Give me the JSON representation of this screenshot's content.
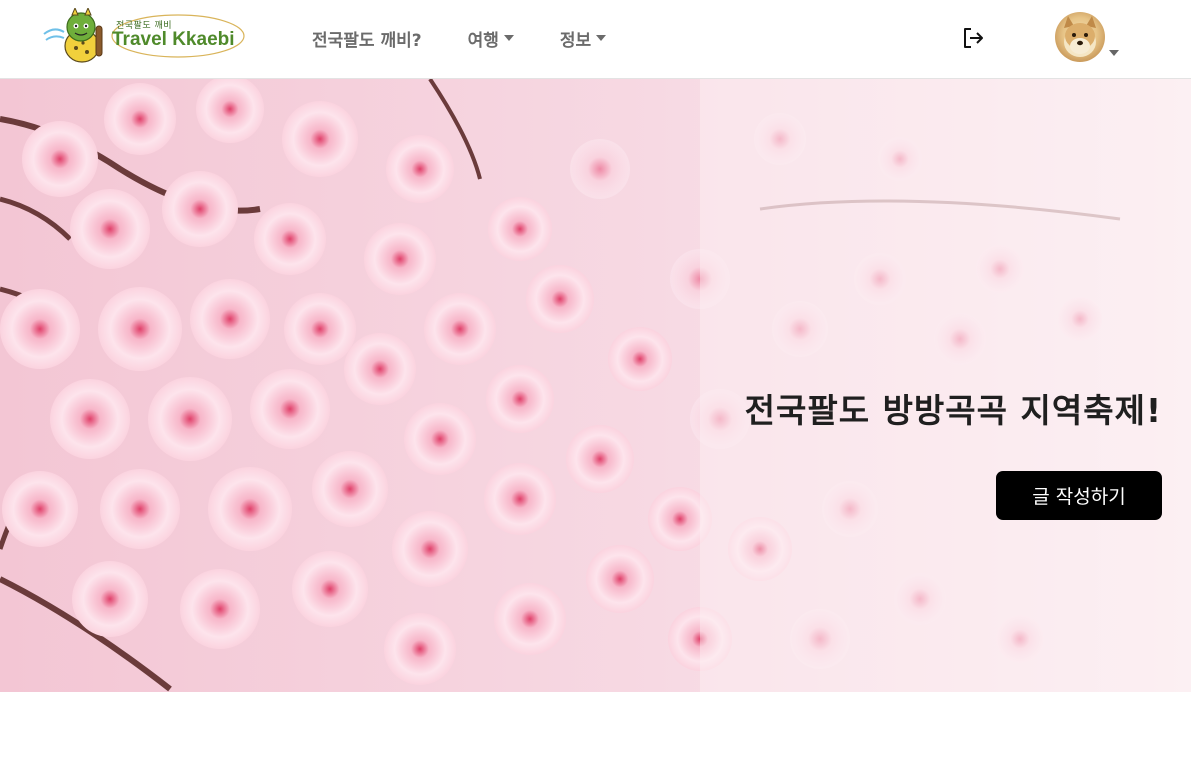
{
  "brand": {
    "small_text": "전국팔도 깨비",
    "name": "Travel Kkaebi",
    "color": "#4f8a2b"
  },
  "nav": {
    "items": [
      {
        "label": "전국팔도 깨비?",
        "has_dropdown": false
      },
      {
        "label": "여행",
        "has_dropdown": true
      },
      {
        "label": "정보",
        "has_dropdown": true
      }
    ]
  },
  "header_right": {
    "logout_icon": "logout-icon",
    "avatar_icon": "user-avatar",
    "avatar_dropdown": "chevron-down-icon"
  },
  "hero": {
    "title": "전국팔도 방방곡곡 지역축제!",
    "cta_label": "글 작성하기",
    "background": "cherry-blossom-photo",
    "cta_color": "#000000"
  }
}
